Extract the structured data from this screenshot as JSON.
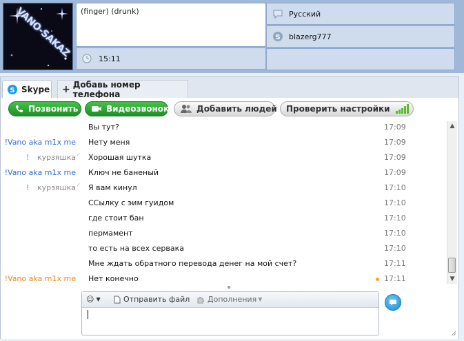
{
  "profile": {
    "avatar_logo_text": "VANO-SAKAZ",
    "mood": "(finger)    (drunk)",
    "local_time": "15:11",
    "language": "Русский",
    "skype_name": "blazerg777"
  },
  "tabs": [
    {
      "label": "Skype"
    },
    {
      "label": "Добавь номер телефона"
    }
  ],
  "actions": {
    "call": "Позвонить",
    "video": "Видеозвонок",
    "add_people": "Добавить людей",
    "check_settings": "Проверить настройки"
  },
  "messages": [
    {
      "sender": "",
      "mark": "",
      "text": "Вы тут?",
      "time": "17:09",
      "sender_color": "none"
    },
    {
      "sender": "!Vano aka m1x me",
      "mark": "",
      "text": "Нету меня",
      "time": "17:09",
      "sender_color": "blue"
    },
    {
      "sender": "курзяшка",
      "mark": "!",
      "text": "Хорошая шутка",
      "time": "17:09",
      "sender_color": "grey",
      "pending": true
    },
    {
      "sender": "!Vano aka m1x me",
      "mark": "",
      "text": "Ключ не баненый",
      "time": "17:09",
      "sender_color": "blue"
    },
    {
      "sender": "курзяшка",
      "mark": "!",
      "text": "Я вам кинул",
      "time": "17:10",
      "sender_color": "grey",
      "pending": true
    },
    {
      "sender": "",
      "mark": "",
      "text": "ССылку с эим гуидом",
      "time": "17:10",
      "sender_color": "none"
    },
    {
      "sender": "",
      "mark": "",
      "text": "где стоит бан",
      "time": "17:10",
      "sender_color": "none"
    },
    {
      "sender": "",
      "mark": "",
      "text": "пермамент",
      "time": "17:10",
      "sender_color": "none"
    },
    {
      "sender": "",
      "mark": "",
      "text": "то есть на всех сервака",
      "time": "17:10",
      "sender_color": "none"
    },
    {
      "sender": "",
      "mark": "",
      "text": "Мне ждать обратного перевода денег на мой счет?",
      "time": "17:11",
      "sender_color": "none"
    },
    {
      "sender": "!Vano aka m1x me",
      "mark": "",
      "text": "Нет конечно",
      "time": "17:11",
      "sender_color": "orange",
      "unread_dot": true
    }
  ],
  "compose": {
    "send_file": "Отправить файл",
    "extras": "Дополнения",
    "input_value": ""
  },
  "colors": {
    "header_bg": "#9fb8d8",
    "sender_blue": "#2f6cd4",
    "sender_orange": "#e58a1f",
    "green_button": "#2ea936"
  }
}
